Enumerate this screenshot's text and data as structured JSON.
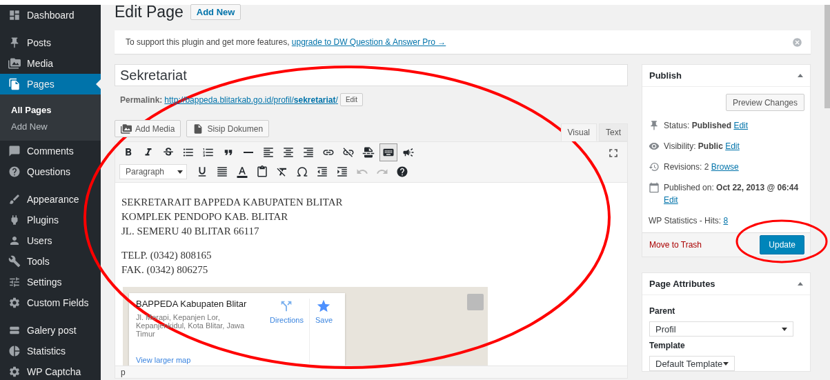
{
  "sidebar": {
    "groups": [
      [
        {
          "label": "Dashboard",
          "kind": "dashboard",
          "selected": false
        }
      ],
      [
        {
          "label": "Posts",
          "kind": "pin",
          "selected": false
        },
        {
          "label": "Media",
          "kind": "media",
          "selected": false
        },
        {
          "label": "Pages",
          "kind": "pages",
          "selected": true,
          "children": [
            {
              "label": "All Pages",
              "selected": true
            },
            {
              "label": "Add New",
              "selected": false
            }
          ]
        },
        {
          "label": "Comments",
          "kind": "comment",
          "selected": false
        },
        {
          "label": "Questions",
          "kind": "question",
          "selected": false
        }
      ],
      [
        {
          "label": "Appearance",
          "kind": "brush",
          "selected": false
        },
        {
          "label": "Plugins",
          "kind": "plug",
          "selected": false
        },
        {
          "label": "Users",
          "kind": "user",
          "selected": false
        },
        {
          "label": "Tools",
          "kind": "wrench",
          "selected": false
        },
        {
          "label": "Settings",
          "kind": "sliders",
          "selected": false
        },
        {
          "label": "Custom Fields",
          "kind": "gear",
          "selected": false
        }
      ],
      [
        {
          "label": "Galery post",
          "kind": "rows",
          "selected": false
        },
        {
          "label": "Statistics",
          "kind": "pie",
          "selected": false
        },
        {
          "label": "WP Captcha",
          "kind": "gear",
          "selected": false
        }
      ]
    ]
  },
  "header": {
    "title": "Edit Page",
    "add_new": "Add New"
  },
  "notice": {
    "text": "To support this plugin and get more features, ",
    "link": "upgrade to DW Question & Answer Pro →"
  },
  "title_field": {
    "value": "Sekretariat"
  },
  "permalink": {
    "label": "Permalink:",
    "url": "http://bappeda.blitarkab.go.id/profil/**sekretariat**/",
    "edit": "Edit"
  },
  "media_buttons": [
    {
      "label": "Add Media",
      "kind": "media"
    },
    {
      "label": "Sisip Dokumen",
      "kind": "document"
    }
  ],
  "editor_tabs": [
    {
      "label": "Visual",
      "selected": true
    },
    {
      "label": "Text",
      "selected": false
    }
  ],
  "toolbar_rows": [
    [
      {
        "kind": "bold",
        "selected": false,
        "disabled": false
      },
      {
        "kind": "italic",
        "selected": false,
        "disabled": false
      },
      {
        "kind": "strike",
        "selected": false,
        "disabled": false
      },
      {
        "kind": "bullets",
        "selected": false,
        "disabled": false
      },
      {
        "kind": "numbers",
        "selected": false,
        "disabled": false
      },
      {
        "kind": "quote",
        "selected": false,
        "disabled": false
      },
      {
        "kind": "hr",
        "selected": false,
        "disabled": false
      },
      {
        "kind": "alignleft",
        "selected": false,
        "disabled": false
      },
      {
        "kind": "aligncenter",
        "selected": false,
        "disabled": false
      },
      {
        "kind": "alignright",
        "selected": false,
        "disabled": false
      },
      {
        "kind": "link",
        "selected": false,
        "disabled": false
      },
      {
        "kind": "unlink",
        "selected": false,
        "disabled": false
      },
      {
        "kind": "more",
        "selected": false,
        "disabled": false
      },
      {
        "kind": "kitchensink",
        "selected": true,
        "disabled": false
      },
      {
        "kind": "megaphone",
        "selected": false,
        "disabled": false
      }
    ],
    [
      {
        "kind": "underline",
        "selected": false,
        "disabled": false
      },
      {
        "kind": "justify",
        "selected": false,
        "disabled": false
      },
      {
        "kind": "textcolor",
        "selected": false,
        "disabled": false
      },
      {
        "kind": "paste",
        "selected": false,
        "disabled": false
      },
      {
        "kind": "clear",
        "selected": false,
        "disabled": false
      },
      {
        "kind": "omega",
        "selected": false,
        "disabled": false
      },
      {
        "kind": "outdent",
        "selected": false,
        "disabled": false
      },
      {
        "kind": "indent",
        "selected": false,
        "disabled": false
      },
      {
        "kind": "undo",
        "selected": false,
        "disabled": true
      },
      {
        "kind": "redo",
        "selected": false,
        "disabled": true
      },
      {
        "kind": "help",
        "selected": false,
        "disabled": false
      }
    ]
  ],
  "format_select": {
    "value": "Paragraph"
  },
  "content": {
    "paragraphs": [
      [
        "SEKRETARAIT BAPPEDA KABUPATEN BLITAR",
        "KOMPLEK PENDOPO KAB. BLITAR",
        "JL. SEMERU 40 BLITAR 66117"
      ],
      [
        "TELP. (0342) 808165",
        "FAK. (0342) 806275"
      ]
    ],
    "map": {
      "place": "BAPPEDA Kabupaten Blitar",
      "address": "Jl. Merapi, Kepanjen Lor, Kepanjenkidul, Kota Blitar, Jawa Timur",
      "directions": "Directions",
      "save": "Save",
      "larger": "View larger map"
    }
  },
  "editor_status": "p",
  "publish": {
    "title": "Publish",
    "preview": "Preview Changes",
    "rows": [
      {
        "kind": "pin",
        "text": "Status: **Published**",
        "link": "Edit"
      },
      {
        "kind": "eye",
        "text": "Visibility: **Public**",
        "link": "Edit"
      },
      {
        "kind": "history",
        "text": "Revisions: 2",
        "link": "Browse"
      },
      {
        "kind": "calendar",
        "text": "Published on: **Oct 22, 2013 @ 06:44**",
        "link": "Edit"
      },
      {
        "kind": "plain",
        "text": "WP Statistics - Hits:",
        "link": "8"
      }
    ],
    "trash": "Move to Trash",
    "update": "Update"
  },
  "page_attributes": {
    "title": "Page Attributes",
    "parent_label": "Parent",
    "parent": "Profil",
    "template_label": "Template",
    "template": "Default Template"
  }
}
